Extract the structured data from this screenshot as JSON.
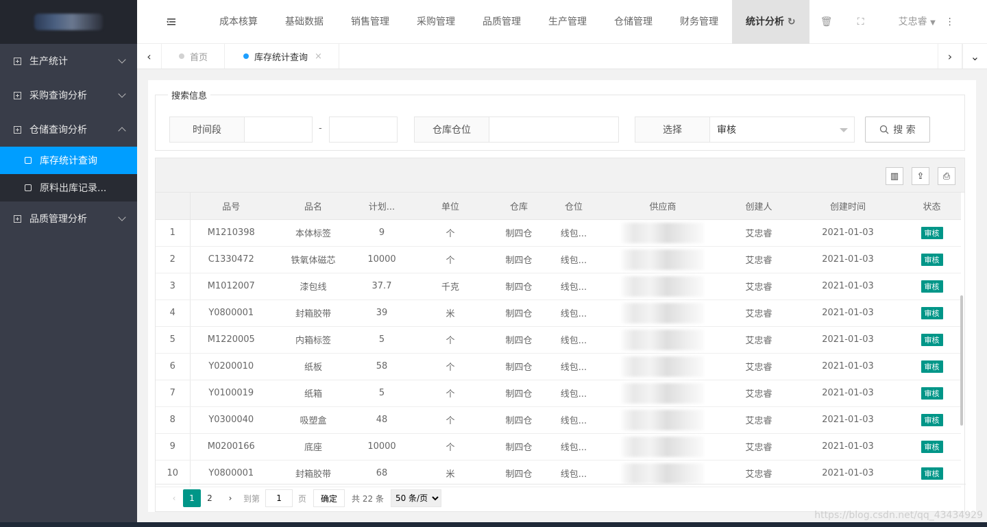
{
  "sidebar": {
    "menu": [
      {
        "label": "生产统计"
      },
      {
        "label": "采购查询分析"
      },
      {
        "label": "仓储查询分析"
      },
      {
        "label": "品质管理分析"
      }
    ],
    "submenu": [
      {
        "label": "库存统计查询"
      },
      {
        "label": "原料出库记录..."
      }
    ]
  },
  "topnav": {
    "items": [
      "成本核算",
      "基础数据",
      "销售管理",
      "采购管理",
      "品质管理",
      "生产管理",
      "仓储管理",
      "财务管理"
    ],
    "active": "统计分析",
    "user": "艾忠睿"
  },
  "tabs": {
    "home": "首页",
    "current": "库存统计查询"
  },
  "search": {
    "legend": "搜索信息",
    "period_label": "时间段",
    "dash": "-",
    "location_label": "仓库仓位",
    "select_label": "选择",
    "select_value": "审核",
    "button": "搜 索"
  },
  "table": {
    "headers": [
      "品号",
      "品名",
      "计划...",
      "单位",
      "仓库",
      "仓位",
      "供应商",
      "创建人",
      "创建时间",
      "状态"
    ],
    "rows": [
      [
        "1",
        "M1210398",
        "本体标签",
        "9",
        "个",
        "制四仓",
        "线包...",
        "艾忠睿",
        "2021-01-03",
        "审核"
      ],
      [
        "2",
        "C1330472",
        "铁氧体磁芯",
        "10000",
        "个",
        "制四仓",
        "线包...",
        "艾忠睿",
        "2021-01-03",
        "审核"
      ],
      [
        "3",
        "M1012007",
        "漆包线",
        "37.7",
        "千克",
        "制四仓",
        "线包...",
        "艾忠睿",
        "2021-01-03",
        "审核"
      ],
      [
        "4",
        "Y0800001",
        "封箱胶带",
        "39",
        "米",
        "制四仓",
        "线包...",
        "艾忠睿",
        "2021-01-03",
        "审核"
      ],
      [
        "5",
        "M1220005",
        "内箱标签",
        "5",
        "个",
        "制四仓",
        "线包...",
        "艾忠睿",
        "2021-01-03",
        "审核"
      ],
      [
        "6",
        "Y0200010",
        "纸板",
        "58",
        "个",
        "制四仓",
        "线包...",
        "艾忠睿",
        "2021-01-03",
        "审核"
      ],
      [
        "7",
        "Y0100019",
        "纸箱",
        "5",
        "个",
        "制四仓",
        "线包...",
        "艾忠睿",
        "2021-01-03",
        "审核"
      ],
      [
        "8",
        "Y0300040",
        "吸塑盒",
        "48",
        "个",
        "制四仓",
        "线包...",
        "艾忠睿",
        "2021-01-03",
        "审核"
      ],
      [
        "9",
        "M0200166",
        "底座",
        "10000",
        "个",
        "制四仓",
        "线包...",
        "艾忠睿",
        "2021-01-03",
        "审核"
      ],
      [
        "10",
        "Y0800001",
        "封箱胶带",
        "68",
        "米",
        "制四仓",
        "线包...",
        "艾忠睿",
        "2021-01-03",
        "审核"
      ]
    ]
  },
  "pager": {
    "page1": "1",
    "page2": "2",
    "goto": "到第",
    "goto_value": "1",
    "page_unit": "页",
    "confirm": "确定",
    "total": "共 22 条",
    "per_page": "50 条/页"
  },
  "watermark": "https://blog.csdn.net/qq_43434929",
  "colors": {
    "accent": "#009eff",
    "badge": "#009688",
    "sidebar": "#393d49"
  }
}
